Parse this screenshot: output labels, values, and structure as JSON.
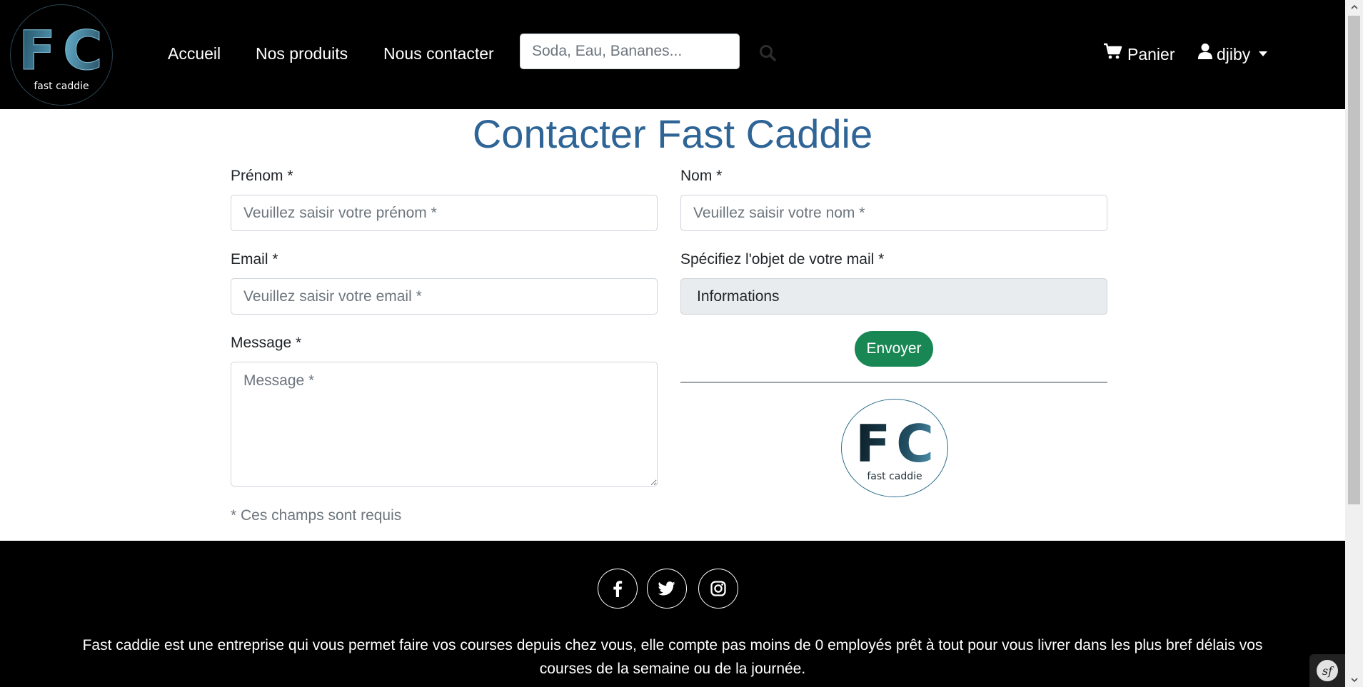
{
  "header": {
    "logo": {
      "letters": "FC",
      "tagline": "fast caddie"
    },
    "nav": {
      "home": "Accueil",
      "products": "Nos produits",
      "contact": "Nous contacter"
    },
    "search": {
      "placeholder": "Soda, Eau, Bananes...",
      "icon": "search-icon"
    },
    "cart": {
      "label": "Panier",
      "icon": "cart-icon"
    },
    "user": {
      "name": "djiby",
      "icon": "user-icon"
    }
  },
  "main": {
    "title": "Contacter Fast Caddie",
    "form": {
      "firstname": {
        "label": "Prénom *",
        "placeholder": "Veuillez saisir votre prénom *"
      },
      "lastname": {
        "label": "Nom *",
        "placeholder": "Veuillez saisir votre nom *"
      },
      "email": {
        "label": "Email *",
        "placeholder": "Veuillez saisir votre email *"
      },
      "subject": {
        "label": "Spécifiez l'objet de votre mail *",
        "value": "Informations"
      },
      "message": {
        "label": "Message *",
        "placeholder": "Message *"
      },
      "submit_label": "Envoyer",
      "required_note": "* Ces champs sont requis"
    },
    "logo": {
      "letters": "FC",
      "tagline": "fast caddie"
    }
  },
  "footer": {
    "social": [
      "facebook-icon",
      "twitter-icon",
      "instagram-icon"
    ],
    "text": "Fast caddie est une entreprise qui vous permet faire vos courses depuis chez vous, elle compte pas moins de 0 employés prêt à tout pour vous livrer dans les plus bref délais vos courses de la semaine ou de la journée.",
    "toolbar_label": "sf"
  },
  "colors": {
    "header_bg": "#000000",
    "title": "#2e6496",
    "submit_button": "#198754",
    "select_bg": "#e9ecef",
    "muted_text": "#6c757d"
  }
}
